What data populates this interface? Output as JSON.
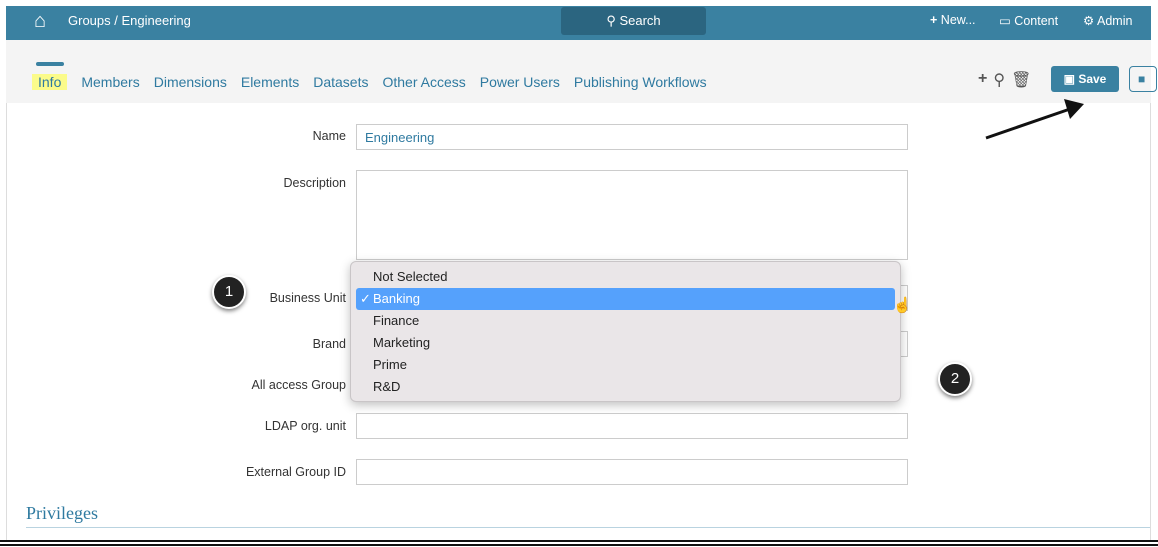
{
  "header": {
    "breadcrumb": "Groups / Engineering",
    "search_label": "Search",
    "new_label": "New...",
    "content_label": "Content",
    "admin_label": "Admin"
  },
  "tabs": [
    {
      "label": "Info",
      "active": true
    },
    {
      "label": "Members"
    },
    {
      "label": "Dimensions"
    },
    {
      "label": "Elements"
    },
    {
      "label": "Datasets"
    },
    {
      "label": "Other Access"
    },
    {
      "label": "Power Users"
    },
    {
      "label": "Publishing Workflows"
    }
  ],
  "toolbar": {
    "save_label": "Save"
  },
  "form": {
    "name_label": "Name",
    "name_value": "Engineering",
    "description_label": "Description",
    "description_value": "",
    "business_unit_label": "Business Unit",
    "brand_label": "Brand",
    "all_access_label": "All access Group",
    "ldap_label": "LDAP org. unit",
    "ldap_value": "",
    "external_id_label": "External Group ID",
    "external_id_value": ""
  },
  "dropdown": {
    "options": [
      "Not Selected",
      "Banking",
      "Finance",
      "Marketing",
      "Prime",
      "R&D"
    ],
    "selected": "Banking",
    "check": "✓"
  },
  "badges": [
    "1",
    "2"
  ],
  "section": {
    "privileges": "Privileges"
  },
  "colors": {
    "brand": "#3a81a1",
    "link": "#2f7aa0",
    "highlight": "#fbfb8a",
    "selected": "#55a1fc"
  }
}
